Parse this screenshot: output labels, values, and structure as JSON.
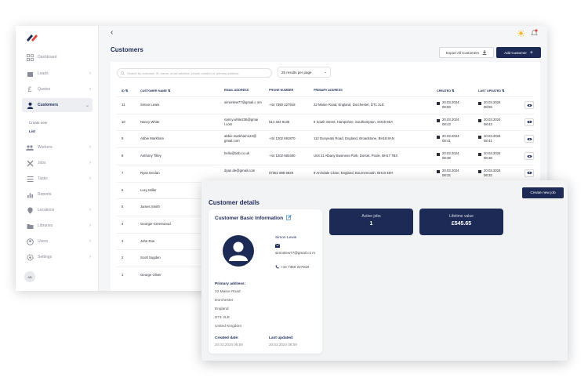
{
  "sidebar": {
    "items": [
      {
        "label": "Dashboard",
        "icon": "grid-icon"
      },
      {
        "label": "Leads",
        "icon": "box-icon"
      },
      {
        "label": "Quotes",
        "icon": "pound-icon"
      },
      {
        "label": "Customers",
        "icon": "user-icon"
      },
      {
        "label": "Workers",
        "icon": "team-icon"
      },
      {
        "label": "Jobs",
        "icon": "tools-icon"
      },
      {
        "label": "Tasks",
        "icon": "list-icon"
      },
      {
        "label": "Reports",
        "icon": "chart-icon"
      },
      {
        "label": "Locations",
        "icon": "pin-icon"
      },
      {
        "label": "Libraries",
        "icon": "folder-icon"
      },
      {
        "label": "Users",
        "icon": "users-icon"
      },
      {
        "label": "Settings",
        "icon": "gear-icon"
      }
    ],
    "sub_items": [
      "Create new",
      "List"
    ],
    "avatar_initials": "AB"
  },
  "list": {
    "title": "Customers",
    "export_label": "Export All Customers",
    "add_label": "Add Customer",
    "search_placeholder": "Search by customer ID, name, email address, phone number or primary address",
    "per_page": "25 results per page",
    "columns": [
      "ID",
      "CUSTOMER NAME",
      "EMAIL ADDRESS",
      "PHONE NUMBER",
      "PRIMARY ADDRESS",
      "CREATED",
      "LAST UPDATED"
    ],
    "rows": [
      {
        "id": "11",
        "name": "Simon Lewis",
        "email": "simonlew77@gmail.c om",
        "phone": "+44 7350 227918",
        "address": "22 Maine Road, England, Dorchester, DT1 2LE",
        "created_d": "20.03.2024",
        "created_t": "08:59",
        "updated_d": "20.03.2024",
        "updated_t": "08:59"
      },
      {
        "id": "10",
        "name": "Nancy White",
        "email": "nancy.white236@gmai l.com",
        "phone": "514 403 9135",
        "address": "5 South Street, Hampshire, Southampton, SO45 6EA",
        "created_d": "20.03.2024",
        "created_t": "08:43",
        "updated_d": "20.03.2024",
        "updated_t": "08:43"
      },
      {
        "id": "9",
        "name": "Abbie Markham",
        "email": "abbie.markham123@ gmail.com",
        "phone": "+44 1202 691870",
        "address": "112 Dunyeats Road, England, Broadstone, BH18 8AN",
        "created_d": "20.03.2024",
        "created_t": "08:41",
        "updated_d": "20.03.2024",
        "updated_t": "08:41"
      },
      {
        "id": "8",
        "name": "Anthony Tilley",
        "email": "hello@b4b.co.uk",
        "phone": "+44 1202 684400",
        "address": "Unit 21 Albany Business Park, Dorset, Poole, BH17 7BX",
        "created_d": "20.03.2024",
        "created_t": "08:38",
        "updated_d": "20.03.2024",
        "updated_t": "08:38"
      },
      {
        "id": "7",
        "name": "Ryan Declan",
        "email": "dyan.de@gmail.com",
        "phone": "07352 888 5929",
        "address": "9 Archdale Close, England, Bournemouth, BH10 4EH",
        "created_d": "20.03.2024",
        "created_t": "08:32",
        "updated_d": "20.03.2024",
        "updated_t": "08:32"
      },
      {
        "id": "6",
        "name": "Lucy Miller"
      },
      {
        "id": "5",
        "name": "James Smith"
      },
      {
        "id": "4",
        "name": "Georgie Greenwood"
      },
      {
        "id": "3",
        "name": "John Doe"
      },
      {
        "id": "2",
        "name": "Scott Sugden"
      },
      {
        "id": "1",
        "name": "George Oliver"
      }
    ]
  },
  "details": {
    "title": "Customer details",
    "new_job_label": "Create new job",
    "card_title": "Customer Basic Information",
    "name": "Simon Lewis",
    "email": "simonlew77@gmail.co m",
    "phone": "+44 7350 227918",
    "address_label": "Primary address:",
    "address_lines": [
      "22 Maine Road",
      "Dorchester",
      "England",
      "DT1 2LE",
      "United Kingdom"
    ],
    "created_label": "Created date:",
    "created_value": "20.03.2024 08:59",
    "updated_label": "Last updated:",
    "updated_value": "20.03.2024 08:59",
    "active_jobs_label": "Active jobs",
    "active_jobs_value": "1",
    "lifetime_label": "Lifetime value",
    "lifetime_value": "£545.65"
  },
  "colors": {
    "navy": "#1d2a55",
    "accent_red": "#e0463a",
    "sun": "#f5b82e"
  }
}
